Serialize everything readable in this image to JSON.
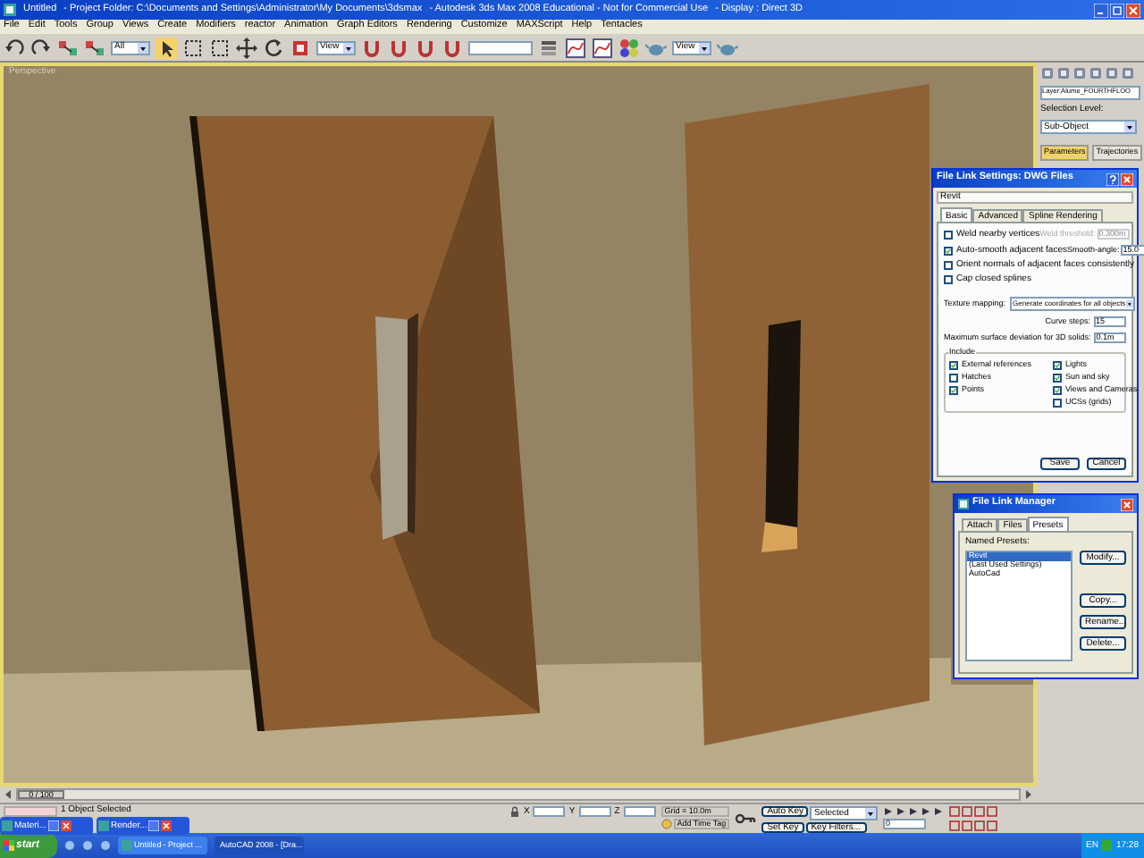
{
  "window": {
    "title_parts": [
      "Untitled",
      "- Project Folder: C:\\Documents and Settings\\Administrator\\My Documents\\3dsmax",
      "- Autodesk 3ds Max 2008  Educational - Not for Commercial Use",
      "- Display : Direct 3D"
    ]
  },
  "menu": [
    "File",
    "Edit",
    "Tools",
    "Group",
    "Views",
    "Create",
    "Modifiers",
    "reactor",
    "Animation",
    "Graph Editors",
    "Rendering",
    "Customize",
    "MAXScript",
    "Help",
    "Tentacles"
  ],
  "toolbar": {
    "selection_filter": "All",
    "reference_coord": "View",
    "render_view": "View"
  },
  "viewport": {
    "label": "Perspective"
  },
  "command_panel": {
    "object_name": "Layer:Alume_FOURTHFLOO",
    "selection_level": "Selection Level:",
    "sub_object": "Sub-Object",
    "tabs": [
      {
        "label": "Parameters",
        "selected": true
      },
      {
        "label": "Trajectories",
        "selected": false
      }
    ]
  },
  "link_settings": {
    "title": "File Link Settings: DWG Files",
    "preset": "Revit",
    "tabs": [
      {
        "label": "Basic",
        "selected": true
      },
      {
        "label": "Advanced",
        "selected": false
      },
      {
        "label": "Spline Rendering",
        "selected": false
      }
    ],
    "options": [
      {
        "label": "Weld nearby vertices",
        "checked": false
      },
      {
        "label": "Auto-smooth adjacent faces",
        "checked": true
      },
      {
        "label": "Orient normals of adjacent faces consistently",
        "checked": false
      },
      {
        "label": "Cap closed splines",
        "checked": false
      }
    ],
    "weld_threshold": {
      "label": "Weld threshold:",
      "value": "0.300m",
      "disabled": true
    },
    "smooth_angle": {
      "label": "Smooth-angle:",
      "value": "15.0"
    },
    "texture_mapping": {
      "label": "Texture mapping:",
      "value": "Generate coordinates for all objects"
    },
    "curve_steps": {
      "label": "Curve steps:",
      "value": "15"
    },
    "max_deviation": {
      "label": "Maximum surface deviation for 3D solids:",
      "value": "0.1m"
    },
    "include_label": "Include",
    "include": [
      {
        "label": "External references",
        "checked": true
      },
      {
        "label": "Lights",
        "checked": true
      },
      {
        "label": "Hatches",
        "checked": false
      },
      {
        "label": "Sun and sky",
        "checked": true
      },
      {
        "label": "Points",
        "checked": true
      },
      {
        "label": "Views and Cameras",
        "checked": true
      },
      {
        "label": "UCSs (grids)",
        "checked": false
      }
    ],
    "buttons": [
      "Save",
      "Cancel"
    ]
  },
  "link_manager": {
    "title": "File Link Manager",
    "tabs": [
      {
        "label": "Attach",
        "selected": false
      },
      {
        "label": "Files",
        "selected": false
      },
      {
        "label": "Presets",
        "selected": true
      }
    ],
    "presets_label": "Named Presets:",
    "presets": [
      {
        "label": "Revit",
        "selected": true
      },
      {
        "label": "(Last Used Settings)",
        "selected": false
      },
      {
        "label": "AutoCad",
        "selected": false
      }
    ],
    "buttons": [
      "Modify...",
      "Copy...",
      "Rename...",
      "Delete..."
    ]
  },
  "time_slider": {
    "position": "0 / 100",
    "level": 0
  },
  "status": {
    "message": "1 Object Selected",
    "x_label": "X",
    "y_label": "Y",
    "z_label": "Z",
    "grid": "Grid = 10.0m",
    "add_time_tag": "Add Time Tag",
    "auto_key": "Auto Key",
    "key_mode": "Selected",
    "set_key": "Set Key",
    "key_filters": "Key Filters...",
    "frame": "0"
  },
  "minimized_windows": [
    "Materi...",
    "Render..."
  ],
  "taskbar": {
    "start": "start",
    "tasks": [
      {
        "label": "Untitled",
        "detail": "- Project ...",
        "selected": false
      },
      {
        "label": "AutoCAD 2008 - [Dra...",
        "selected": true
      }
    ],
    "language": "EN",
    "clock": "17:28"
  }
}
